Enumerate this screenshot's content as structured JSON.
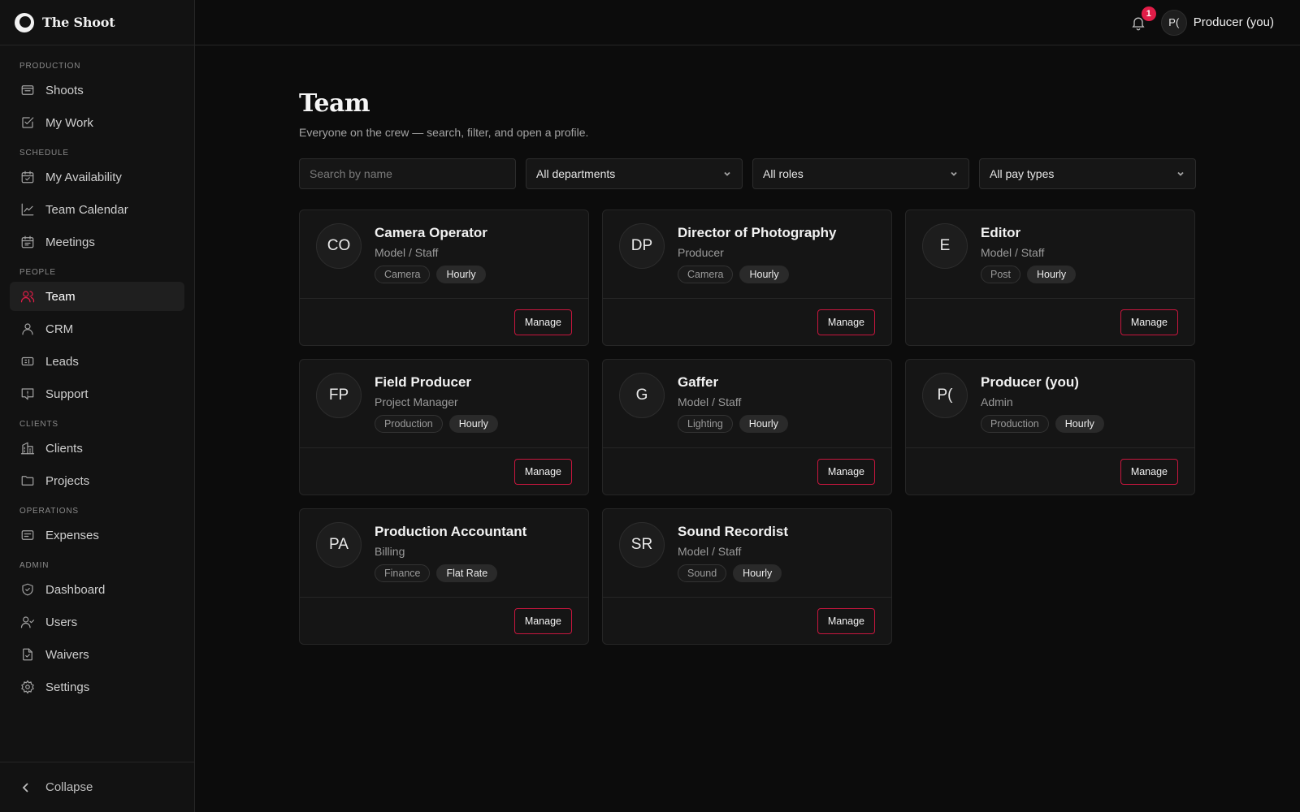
{
  "app": {
    "name": "The Shoot"
  },
  "sidebar": {
    "sections": [
      {
        "label": "PRODUCTION",
        "items": [
          {
            "label": "Shoots",
            "icon": "inbox-icon"
          },
          {
            "label": "My Work",
            "icon": "checkbox-icon"
          }
        ]
      },
      {
        "label": "SCHEDULE",
        "items": [
          {
            "label": "My Availability",
            "icon": "calendar-check-icon"
          },
          {
            "label": "Team Calendar",
            "icon": "line-chart-icon"
          },
          {
            "label": "Meetings",
            "icon": "calendar-icon"
          }
        ]
      },
      {
        "label": "PEOPLE",
        "items": [
          {
            "label": "Team",
            "icon": "users-icon",
            "active": true
          },
          {
            "label": "CRM",
            "icon": "user-icon"
          },
          {
            "label": "Leads",
            "icon": "ticket-icon"
          },
          {
            "label": "Support",
            "icon": "message-alert-icon"
          }
        ]
      },
      {
        "label": "CLIENTS",
        "items": [
          {
            "label": "Clients",
            "icon": "building-icon"
          },
          {
            "label": "Projects",
            "icon": "folder-icon"
          }
        ]
      },
      {
        "label": "OPERATIONS",
        "items": [
          {
            "label": "Expenses",
            "icon": "receipt-icon"
          }
        ]
      },
      {
        "label": "ADMIN",
        "items": [
          {
            "label": "Dashboard",
            "icon": "shield-check-icon"
          },
          {
            "label": "Users",
            "icon": "user-check-icon"
          },
          {
            "label": "Waivers",
            "icon": "file-check-icon"
          },
          {
            "label": "Settings",
            "icon": "gear-icon"
          }
        ]
      }
    ],
    "collapse_label": "Collapse"
  },
  "topbar": {
    "notification_count": "1",
    "user_initials": "P(",
    "user_name": "Producer (you)"
  },
  "page": {
    "title": "Team",
    "subtitle": "Everyone on the crew — search, filter, and open a profile."
  },
  "filters": {
    "search_placeholder": "Search by name",
    "department": "All departments",
    "role": "All roles",
    "pay_type": "All pay types"
  },
  "members": [
    {
      "initials": "CO",
      "name": "Camera Operator",
      "role": "Model / Staff",
      "department": "Camera",
      "pay_type": "Hourly",
      "action": "Manage"
    },
    {
      "initials": "DP",
      "name": "Director of Photography",
      "role": "Producer",
      "department": "Camera",
      "pay_type": "Hourly",
      "action": "Manage"
    },
    {
      "initials": "E",
      "name": "Editor",
      "role": "Model / Staff",
      "department": "Post",
      "pay_type": "Hourly",
      "action": "Manage"
    },
    {
      "initials": "FP",
      "name": "Field Producer",
      "role": "Project Manager",
      "department": "Production",
      "pay_type": "Hourly",
      "action": "Manage"
    },
    {
      "initials": "G",
      "name": "Gaffer",
      "role": "Model / Staff",
      "department": "Lighting",
      "pay_type": "Hourly",
      "action": "Manage"
    },
    {
      "initials": "P(",
      "name": "Producer (you)",
      "role": "Admin",
      "department": "Production",
      "pay_type": "Hourly",
      "action": "Manage"
    },
    {
      "initials": "PA",
      "name": "Production Accountant",
      "role": "Billing",
      "department": "Finance",
      "pay_type": "Flat Rate",
      "action": "Manage"
    },
    {
      "initials": "SR",
      "name": "Sound Recordist",
      "role": "Model / Staff",
      "department": "Sound",
      "pay_type": "Hourly",
      "action": "Manage"
    }
  ],
  "colors": {
    "accent": "#e11d48",
    "background": "#0c0c0c",
    "card": "#151515"
  }
}
